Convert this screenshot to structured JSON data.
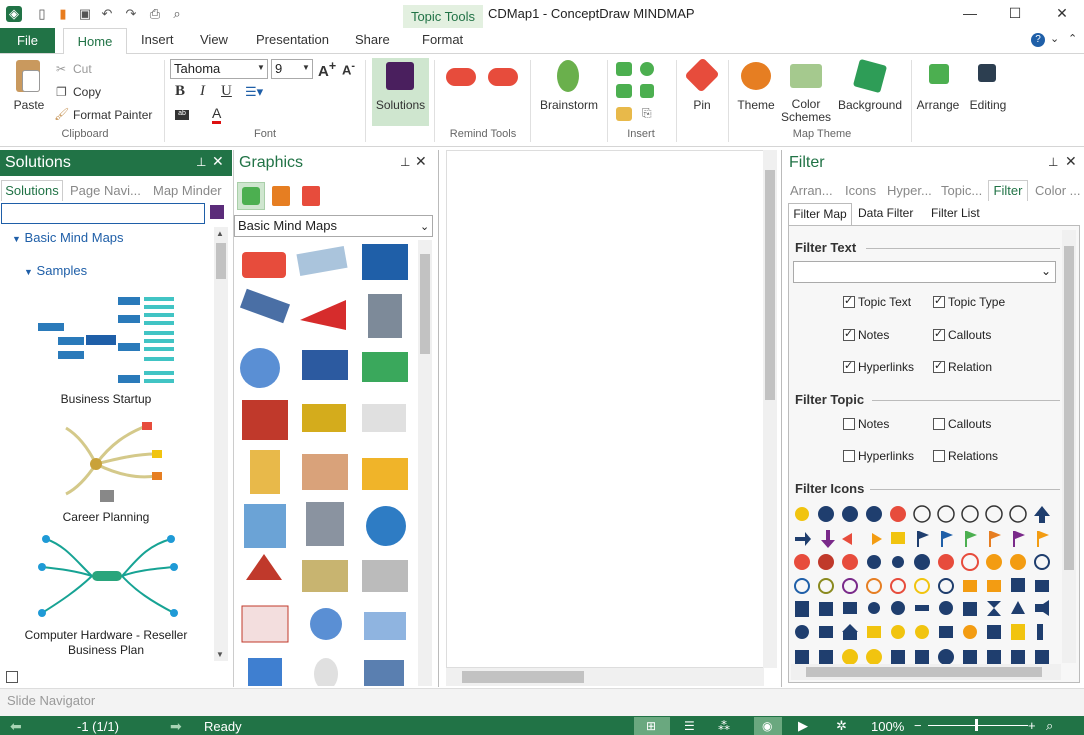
{
  "app": {
    "context_tab": "Topic Tools",
    "title": "CDMap1 - ConceptDraw MINDMAP"
  },
  "menu": {
    "file": "File",
    "tabs": [
      "Home",
      "Insert",
      "View",
      "Presentation",
      "Share",
      "Format"
    ]
  },
  "ribbon": {
    "paste": "Paste",
    "cut": "Cut",
    "copy": "Copy",
    "format_painter": "Format Painter",
    "clipboard_group": "Clipboard",
    "font_name": "Tahoma",
    "font_size": "9",
    "font_group": "Font",
    "solutions": "Solutions",
    "remind_group": "Remind Tools",
    "brainstorm": "Brainstorm",
    "insert_group": "Insert",
    "pin": "Pin",
    "theme": "Theme",
    "color_schemes": "Color Schemes",
    "background": "Background",
    "map_theme_group": "Map Theme",
    "arrange": "Arrange",
    "editing": "Editing"
  },
  "solutions_panel": {
    "title": "Solutions",
    "tabs": [
      "Solutions",
      "Page Navi...",
      "Map Minder"
    ],
    "tree_root": "Basic Mind Maps",
    "tree_child": "Samples",
    "items": [
      "Business Startup",
      "Career Planning",
      "Computer Hardware - Reseller Business Plan"
    ]
  },
  "graphics_panel": {
    "title": "Graphics",
    "library": "Basic Mind Maps"
  },
  "filter_panel": {
    "title": "Filter",
    "tabs": [
      "Arran...",
      "Icons",
      "Hyper...",
      "Topic...",
      "Filter",
      "Color ..."
    ],
    "subtabs": [
      "Filter Map",
      "Data Filter",
      "Filter List"
    ],
    "filter_text_heading": "Filter Text",
    "text_options": [
      {
        "label": "Topic Text",
        "checked": true
      },
      {
        "label": "Topic Type",
        "checked": true
      },
      {
        "label": "Notes",
        "checked": true
      },
      {
        "label": "Callouts",
        "checked": true
      },
      {
        "label": "Hyperlinks",
        "checked": true
      },
      {
        "label": "Relation",
        "checked": true
      }
    ],
    "filter_topic_heading": "Filter Topic",
    "topic_options": [
      {
        "label": "Notes",
        "checked": false
      },
      {
        "label": "Callouts",
        "checked": false
      },
      {
        "label": "Hyperlinks",
        "checked": false
      },
      {
        "label": "Relations",
        "checked": false
      }
    ],
    "filter_icons_heading": "Filter Icons"
  },
  "slide_navigator": "Slide Navigator",
  "status": {
    "page": "-1 (1/1)",
    "state": "Ready",
    "zoom": "100%"
  },
  "colors": {
    "brand_green": "#217346",
    "accent_blue": "#1f5fa8"
  }
}
